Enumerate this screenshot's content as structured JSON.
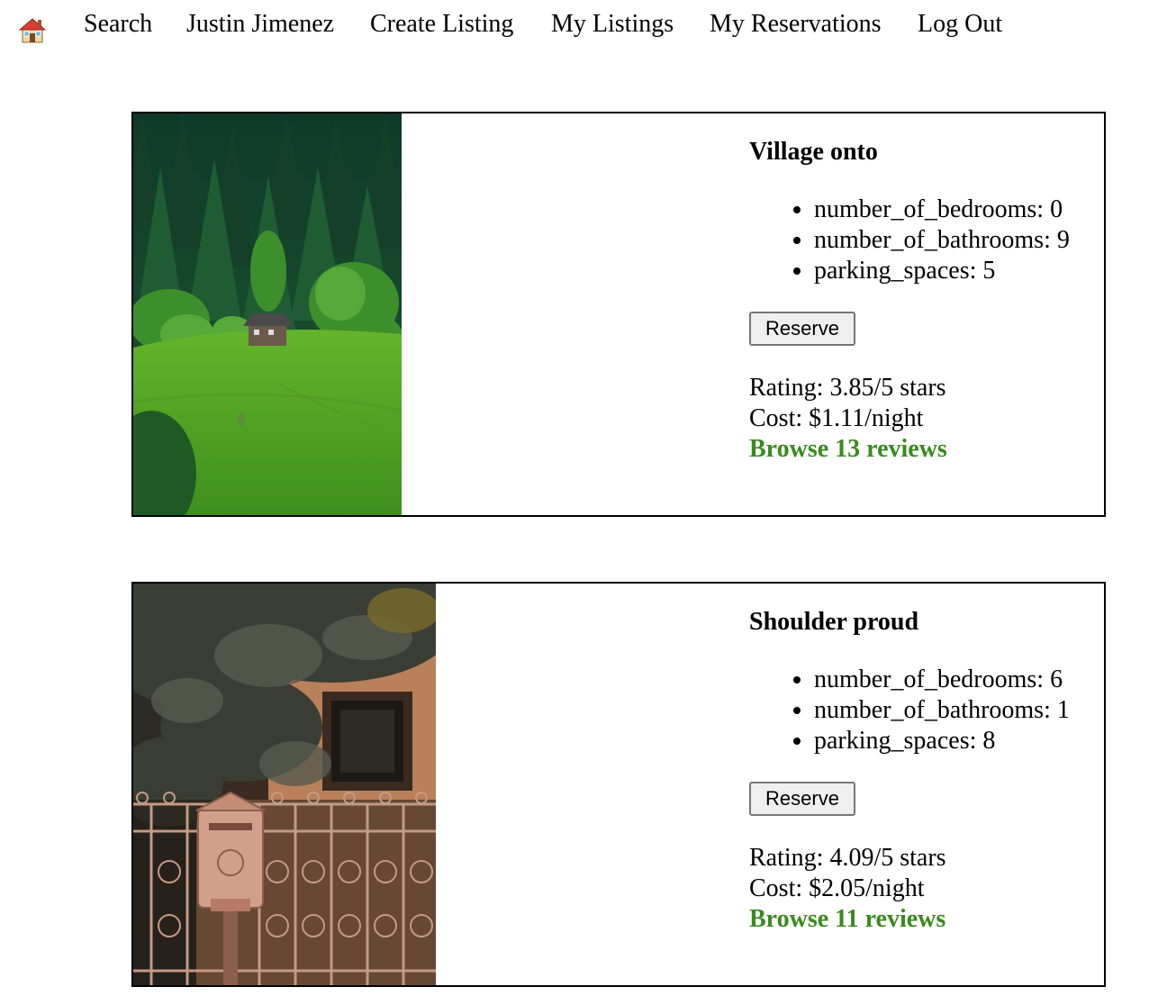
{
  "nav": {
    "home_icon": "house-icon",
    "links": [
      "Search",
      "Justin Jimenez",
      "Create Listing",
      "My Listings",
      "My Reservations",
      "Log Out"
    ]
  },
  "listings": [
    {
      "title": "Village onto",
      "features": [
        "number_of_bedrooms: 0",
        "number_of_bathrooms: 9",
        "parking_spaces: 5"
      ],
      "reserve_label": "Reserve",
      "rating": "Rating: 3.85/5 stars",
      "cost": "Cost: $1.11/night",
      "reviews_link": "Browse 13 reviews"
    },
    {
      "title": "Shoulder proud",
      "features": [
        "number_of_bedrooms: 6",
        "number_of_bathrooms: 1",
        "parking_spaces: 8"
      ],
      "reserve_label": "Reserve",
      "rating": "Rating: 4.09/5 stars",
      "cost": "Cost: $2.05/night",
      "reviews_link": "Browse 11 reviews"
    }
  ],
  "colors": {
    "link_green": "#3a8a1f",
    "card_border": "#000000"
  }
}
